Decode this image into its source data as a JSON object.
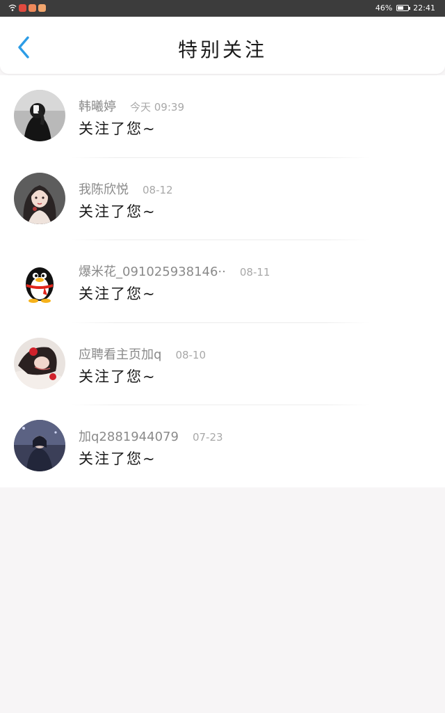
{
  "status_bar": {
    "battery_text": "46%",
    "battery_level": 0.46,
    "time": "22:41",
    "app_icons": [
      {
        "name": "wifi-icon",
        "color": "#ffffff"
      },
      {
        "name": "message-app-icon",
        "color": "#e04a3f"
      },
      {
        "name": "chat-app-icon",
        "color": "#ef8a5b"
      },
      {
        "name": "chat-app-icon-2",
        "color": "#f2a66e"
      }
    ]
  },
  "header": {
    "title": "特别关注",
    "back_icon": "chevron-left-icon",
    "accent_color": "#2c9ce6"
  },
  "items": [
    {
      "name": "韩曦婷",
      "time": "今天 09:39",
      "message": "关注了您~",
      "avatar": "photo-avatar-dark"
    },
    {
      "name": "我陈欣悦",
      "time": "08-12",
      "message": "关注了您~",
      "avatar": "illustrated-girl-avatar"
    },
    {
      "name": "爆米花_091025938146··",
      "time": "08-11",
      "message": "关注了您~",
      "avatar": "qq-penguin-avatar"
    },
    {
      "name": "应聘看主页加q",
      "time": "08-10",
      "message": "关注了您~",
      "avatar": "photo-avatar-flower"
    },
    {
      "name": "加q2881944079",
      "time": "07-23",
      "message": "关注了您~",
      "avatar": "photo-avatar-night"
    }
  ]
}
